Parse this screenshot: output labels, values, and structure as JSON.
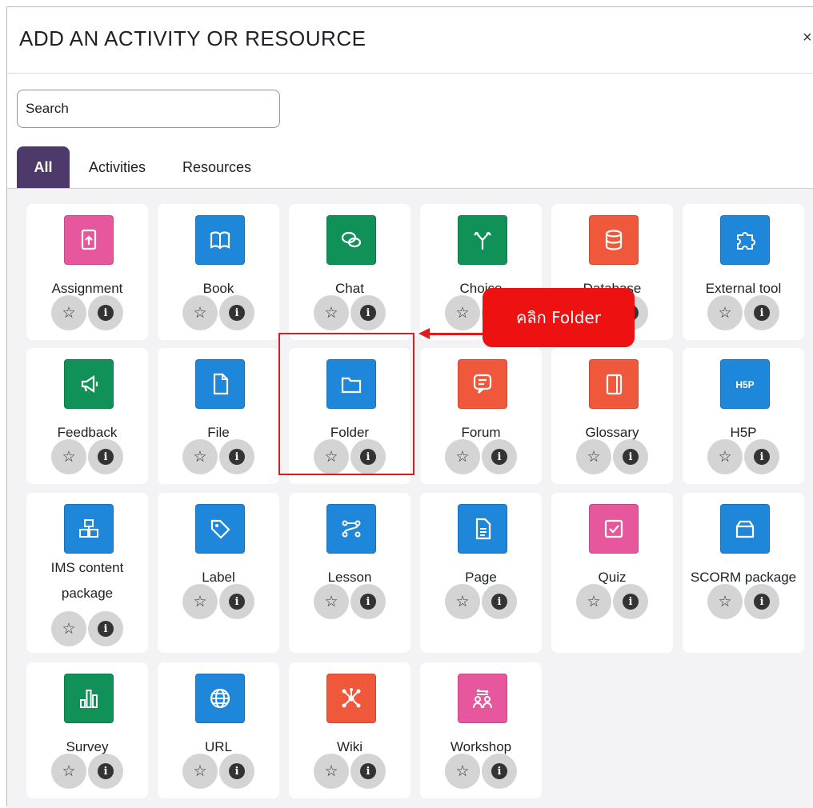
{
  "modal": {
    "title": "ADD AN ACTIVITY OR RESOURCE",
    "close": "×"
  },
  "search": {
    "placeholder": "Search"
  },
  "tabs": [
    "All",
    "Activities",
    "Resources"
  ],
  "colors": {
    "tab_active": "#4e3a6a",
    "pink": "#e6579e",
    "blue": "#1f87d9",
    "green": "#0f9158",
    "red": "#f0583b",
    "annotation": "#e01b1b"
  },
  "modules": [
    {
      "label": "Assignment",
      "icon": "assignment-icon",
      "color": "pink"
    },
    {
      "label": "Book",
      "icon": "book-icon",
      "color": "blue"
    },
    {
      "label": "Chat",
      "icon": "chat-icon",
      "color": "green"
    },
    {
      "label": "Choice",
      "icon": "choice-icon",
      "color": "green"
    },
    {
      "label": "Database",
      "icon": "database-icon",
      "color": "red"
    },
    {
      "label": "External tool",
      "icon": "puzzle-icon",
      "color": "blue"
    },
    {
      "label": "Feedback",
      "icon": "megaphone-icon",
      "color": "green"
    },
    {
      "label": "File",
      "icon": "file-icon",
      "color": "blue"
    },
    {
      "label": "Folder",
      "icon": "folder-icon",
      "color": "blue"
    },
    {
      "label": "Forum",
      "icon": "forum-icon",
      "color": "red"
    },
    {
      "label": "Glossary",
      "icon": "glossary-icon",
      "color": "red"
    },
    {
      "label": "H5P",
      "icon": "h5p-icon",
      "color": "blue"
    },
    {
      "label": "IMS content package",
      "label_lines": [
        "IMS content",
        "package"
      ],
      "icon": "ims-package-icon",
      "color": "blue"
    },
    {
      "label": "Label",
      "icon": "tag-icon",
      "color": "blue"
    },
    {
      "label": "Lesson",
      "icon": "lesson-icon",
      "color": "blue"
    },
    {
      "label": "Page",
      "icon": "page-icon",
      "color": "blue"
    },
    {
      "label": "Quiz",
      "icon": "quiz-icon",
      "color": "pink"
    },
    {
      "label": "SCORM package",
      "icon": "scorm-icon",
      "color": "blue"
    },
    {
      "label": "Survey",
      "icon": "survey-icon",
      "color": "green"
    },
    {
      "label": "URL",
      "icon": "globe-icon",
      "color": "blue"
    },
    {
      "label": "Wiki",
      "icon": "wiki-icon",
      "color": "red"
    },
    {
      "label": "Workshop",
      "icon": "workshop-icon",
      "color": "pink"
    }
  ],
  "annotation": {
    "text": "คลิก Folder",
    "target": "Folder"
  }
}
